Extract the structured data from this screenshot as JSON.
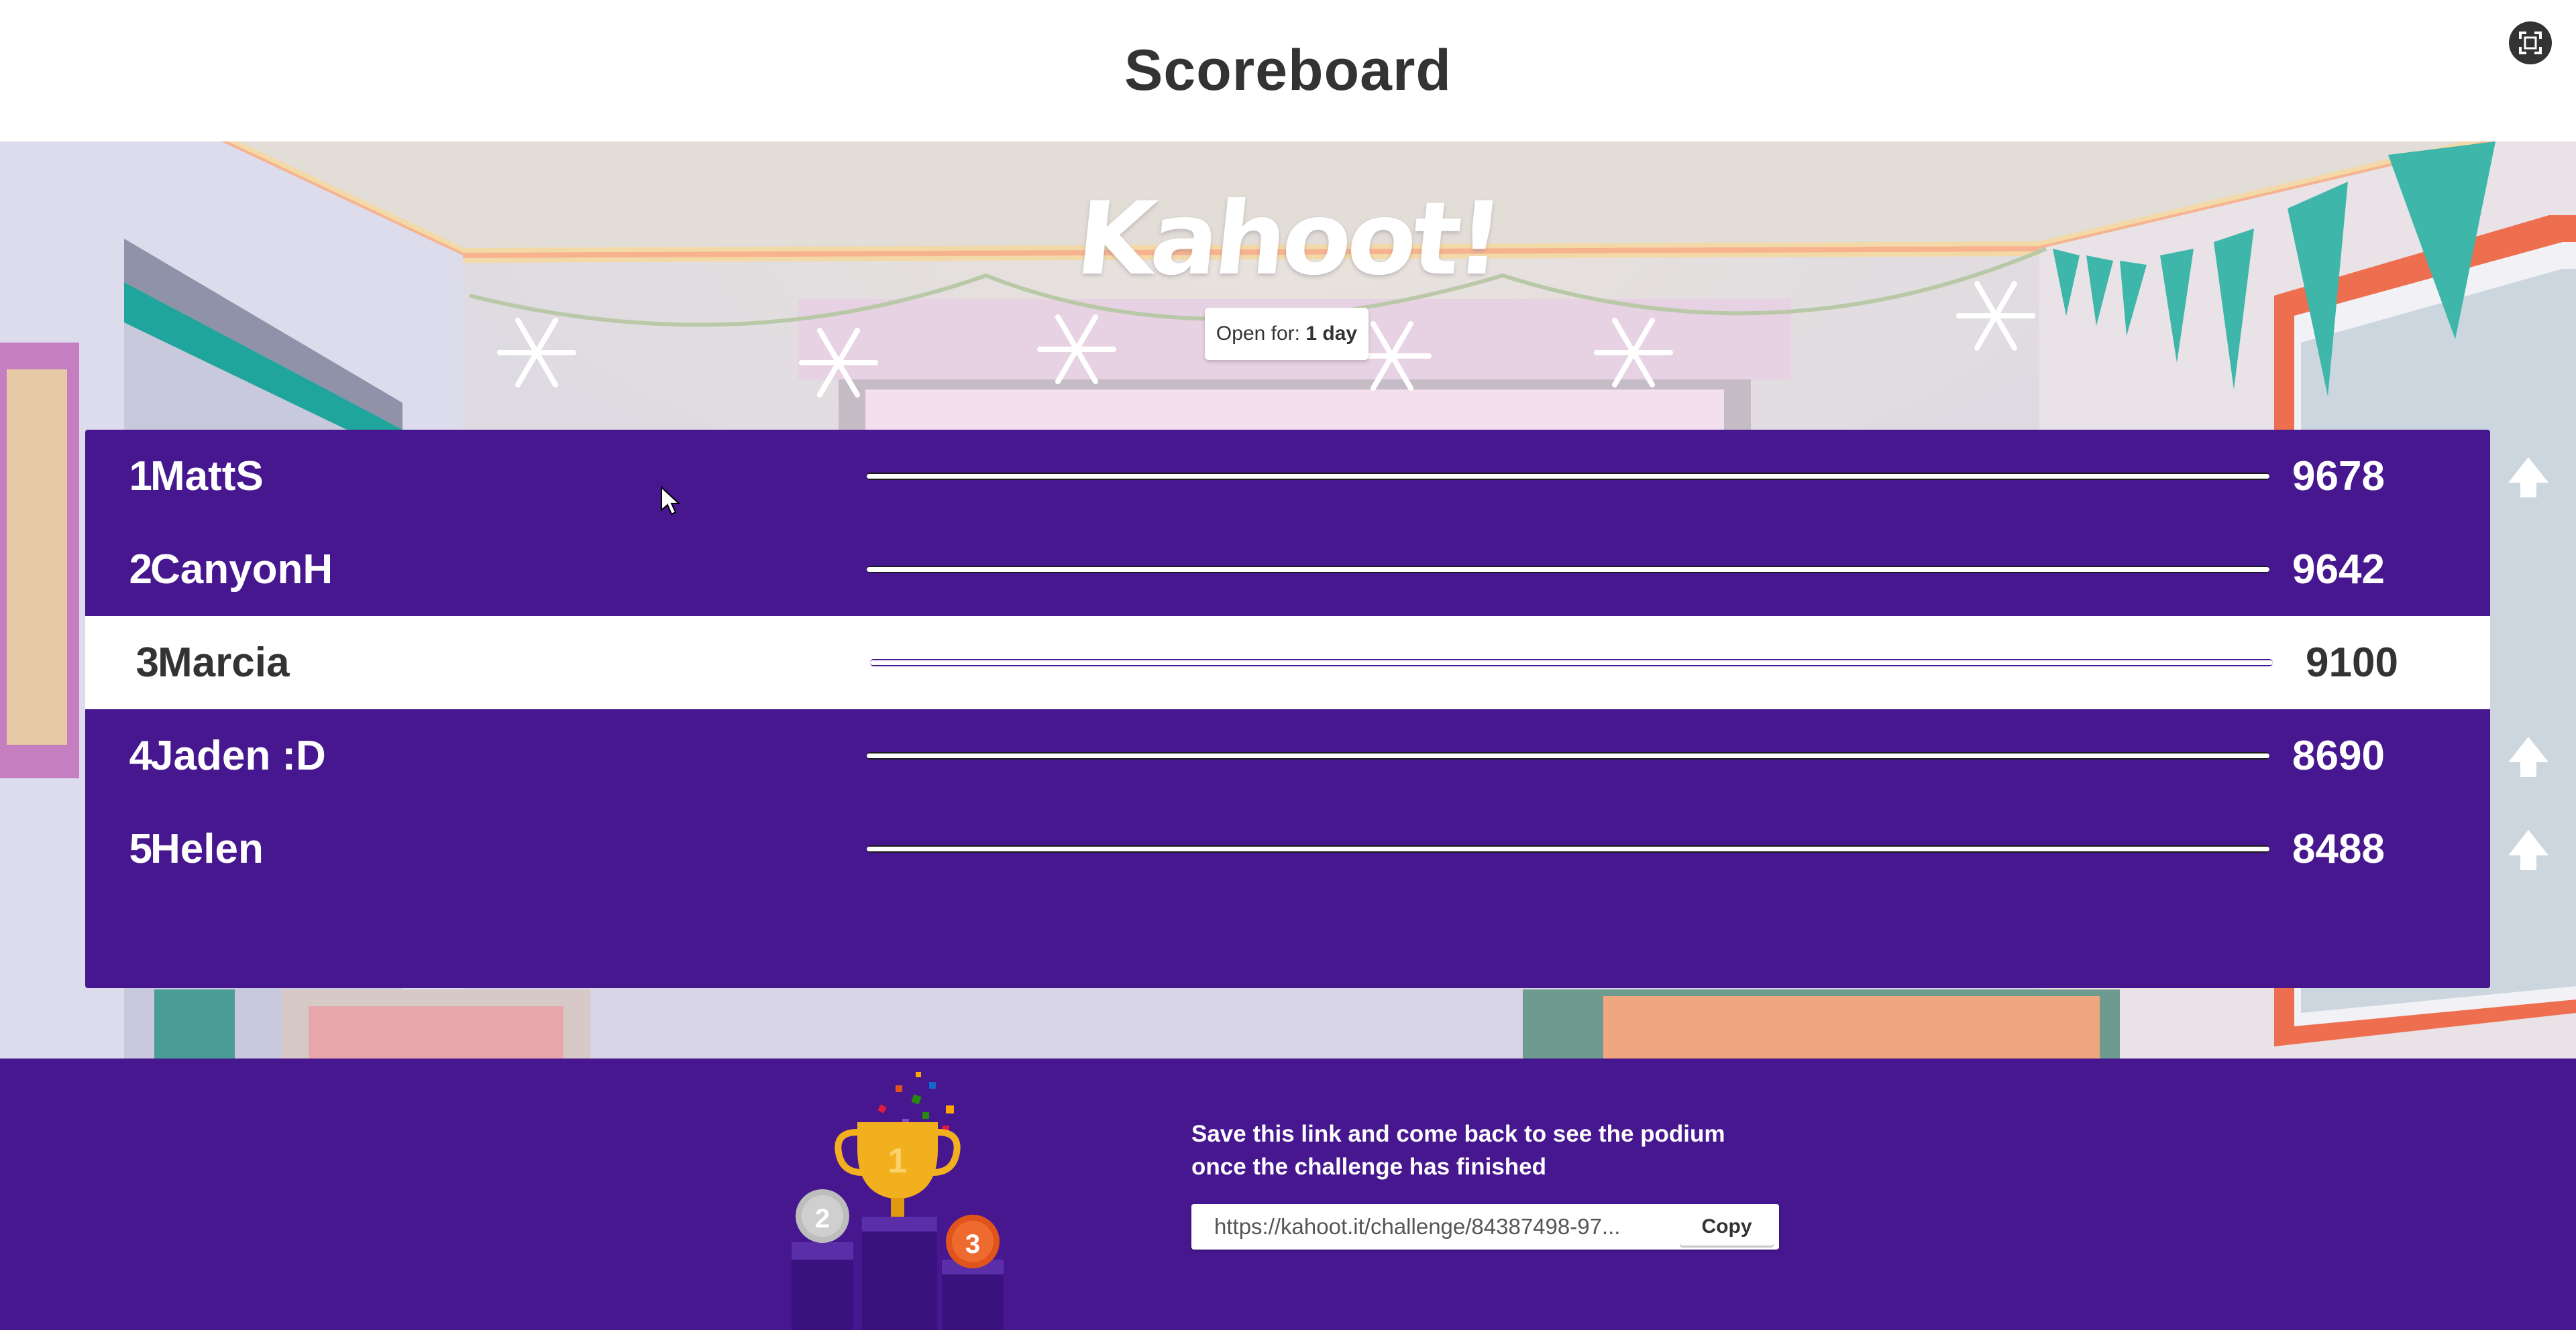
{
  "header": {
    "title": "Scoreboard",
    "fullscreen_icon": "fullscreen-icon"
  },
  "brand": {
    "logo_text": "Kahoot!"
  },
  "status": {
    "open_label": "Open for:",
    "open_value": "1 day"
  },
  "leaderboard": {
    "rows": [
      {
        "rank": "1",
        "name": "MattS",
        "score": "9678",
        "trend": "up",
        "fill": 1.0
      },
      {
        "rank": "2",
        "name": "CanyonH",
        "score": "9642",
        "trend": "none",
        "fill": 1.0
      },
      {
        "rank": "3",
        "name": "Marcia",
        "score": "9100",
        "trend": "none",
        "fill": 1.0,
        "highlighted": true
      },
      {
        "rank": "4",
        "name": "Jaden :D",
        "score": "8690",
        "trend": "up",
        "fill": 1.0
      },
      {
        "rank": "5",
        "name": "Helen",
        "score": "8488",
        "trend": "up",
        "fill": 1.0
      }
    ]
  },
  "footer": {
    "message_line1": "Save this link and come back to see the podium",
    "message_line2": "once the challenge has finished",
    "link_value": "https://kahoot.it/challenge/84387498-97...",
    "copy_label": "Copy",
    "podium": {
      "first": "1",
      "second": "2",
      "third": "3"
    }
  },
  "colors": {
    "brand_purple": "#46178f",
    "highlight_row": "#ffffff",
    "trophy_gold": "#f2b01e",
    "bronze": "#e0541c",
    "silver": "#bdbdbd"
  }
}
